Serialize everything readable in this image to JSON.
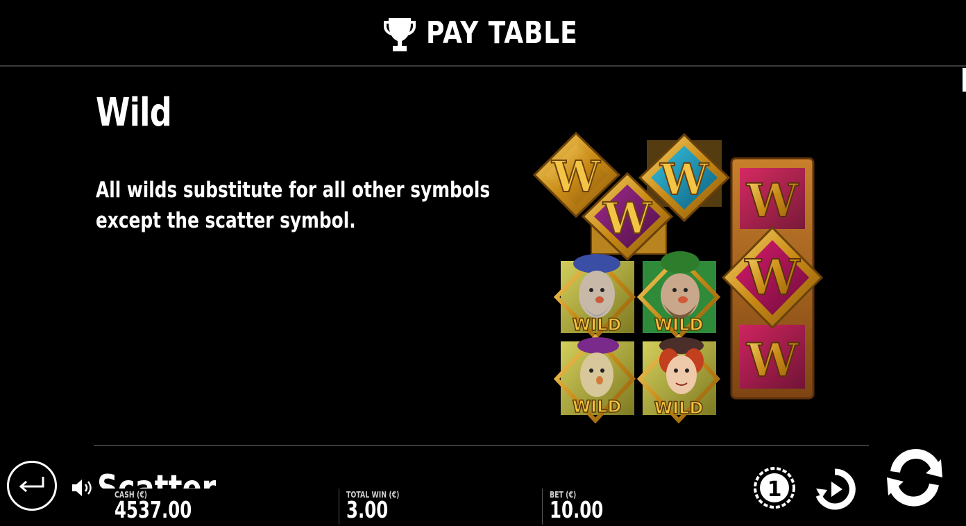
{
  "header": {
    "title": "PAY TABLE",
    "icon": "trophy-icon"
  },
  "section": {
    "title": "Wild",
    "description": "All wilds substitute for all other symbols except the scatter symbol."
  },
  "symbols": {
    "wild_label": "WILD",
    "w_letter": "W"
  },
  "next_section": {
    "title": "Scatter"
  },
  "footer": {
    "cash_label": "CASH (€)",
    "cash_value": "4537.00",
    "total_win_label": "TOTAL WIN (€)",
    "total_win_value": "3.00",
    "bet_label": "BET (€)",
    "bet_value": "10.00"
  },
  "colors": {
    "gold": "#d9a521",
    "purple": "#7b1d6e",
    "teal": "#1a8fb0",
    "magenta": "#b0105a"
  }
}
